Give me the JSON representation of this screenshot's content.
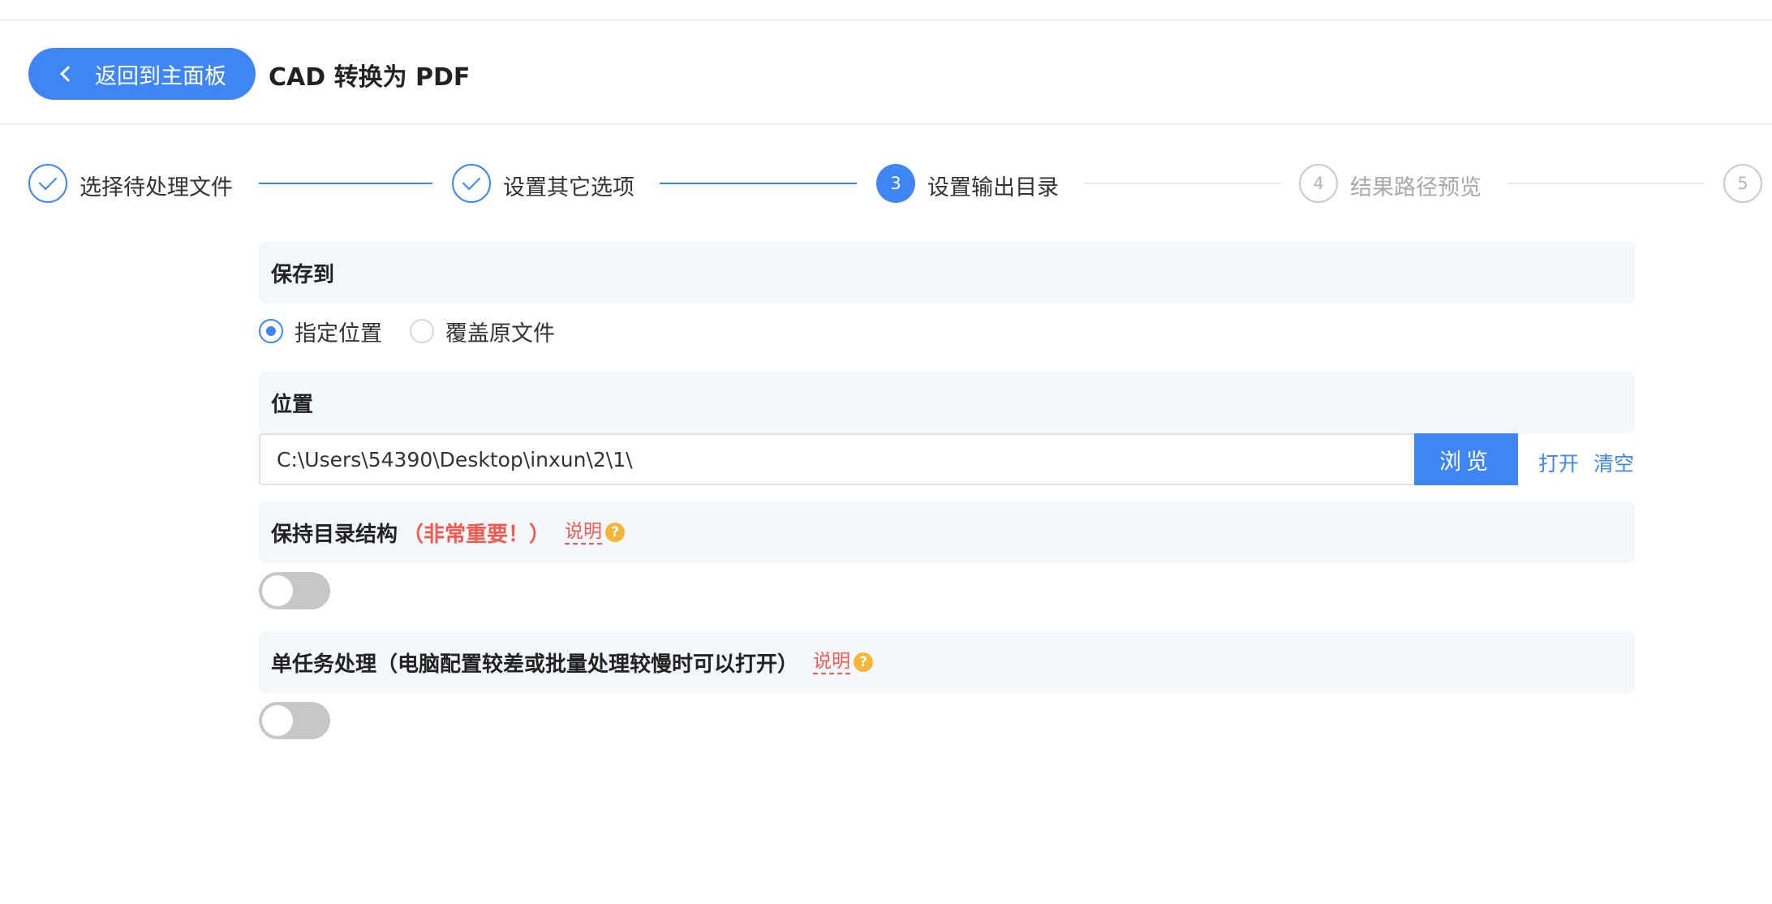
{
  "header": {
    "back_label": "返回到主面板",
    "title": "CAD 转换为 PDF"
  },
  "steps": [
    {
      "label": "选择待处理文件",
      "state": "done",
      "number": "1"
    },
    {
      "label": "设置其它选项",
      "state": "done",
      "number": "2"
    },
    {
      "label": "设置输出目录",
      "state": "active",
      "number": "3"
    },
    {
      "label": "结果路径预览",
      "state": "pending",
      "number": "4"
    },
    {
      "label": "",
      "state": "pending",
      "number": "5"
    }
  ],
  "save_to": {
    "heading": "保存到",
    "options": [
      {
        "label": "指定位置",
        "checked": true
      },
      {
        "label": "覆盖原文件",
        "checked": false
      }
    ]
  },
  "location": {
    "heading": "位置",
    "path": "C:\\Users\\54390\\Desktop\\inxun\\2\\1\\",
    "browse_label": "浏览",
    "open_label": "打开",
    "clear_label": "清空"
  },
  "keep_structure": {
    "heading": "保持目录结构",
    "warning": "（非常重要！）",
    "explain": "说明",
    "enabled": false
  },
  "single_task": {
    "heading": "单任务处理（电脑配置较差或批量处理较慢时可以打开）",
    "explain": "说明",
    "enabled": false
  },
  "colors": {
    "accent": "#3f86f4",
    "warning": "#f05a50",
    "help_icon": "#f5b53a",
    "section_bg": "#f4f8fd",
    "toggle_off": "#c7c7c7"
  },
  "icons": {
    "back": "chevron-left-icon",
    "done": "check-icon",
    "help": "question-icon"
  }
}
